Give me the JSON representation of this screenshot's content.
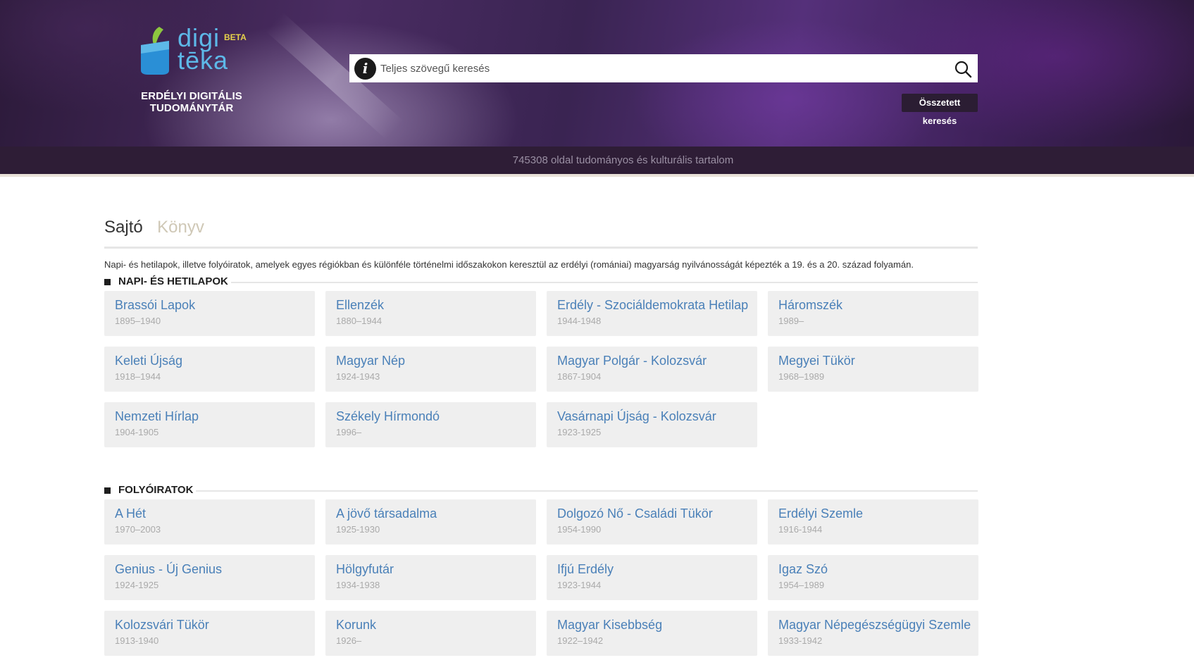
{
  "header": {
    "logo": {
      "line1": "digi",
      "line2": "tēka",
      "badge": "BETA"
    },
    "tagline": "ERDÉLYI DIGITÁLIS TUDOMÁNYTÁR",
    "search": {
      "placeholder": "Teljes szövegű keresés",
      "value": ""
    },
    "advanced_search_label": "Összetett keresés",
    "icons": {
      "info": "info-icon",
      "search": "search-icon"
    },
    "colors": {
      "logo_text": "#5db8e8",
      "logo_leaf": "#8dc63f",
      "badge": "#e6d24a"
    }
  },
  "stats": {
    "text": "745308 oldal tudományos és kulturális tartalom"
  },
  "tabs": [
    {
      "label": "Sajtó",
      "active": true
    },
    {
      "label": "Könyv",
      "active": false
    }
  ],
  "description": "Napi- és hetilapok, illetve folyóiratok, amelyek egyes régiókban és különféle történelmi időszakokon keresztül az erdélyi (romániai) magyarság nyilvánosságát képezték a 19. és a 20. század folyamán.",
  "sections": [
    {
      "title": "NAPI- ÉS HETILAPOK",
      "items": [
        {
          "name": "Brassói Lapok",
          "years": "1895–1940"
        },
        {
          "name": "Ellenzék",
          "years": "1880–1944"
        },
        {
          "name": "Erdély - Szociáldemokrata Hetilap",
          "years": "1944-1948"
        },
        {
          "name": "Háromszék",
          "years": "1989–"
        },
        {
          "name": "Keleti Újság",
          "years": "1918–1944"
        },
        {
          "name": "Magyar Nép",
          "years": "1924-1943"
        },
        {
          "name": "Magyar Polgár - Kolozsvár",
          "years": "1867-1904"
        },
        {
          "name": "Megyei Tükör",
          "years": "1968–1989"
        },
        {
          "name": "Nemzeti Hírlap",
          "years": "1904-1905"
        },
        {
          "name": "Székely Hírmondó",
          "years": "1996–"
        },
        {
          "name": "Vasárnapi Újság - Kolozsvár",
          "years": "1923-1925"
        }
      ]
    },
    {
      "title": "FOLYÓIRATOK",
      "items": [
        {
          "name": "A Hét",
          "years": "1970–2003"
        },
        {
          "name": "A jövő társadalma",
          "years": "1925-1930"
        },
        {
          "name": "Dolgozó Nő - Családi Tükör",
          "years": "1954-1990"
        },
        {
          "name": "Erdélyi Szemle",
          "years": "1916-1944"
        },
        {
          "name": "Genius - Új Genius",
          "years": "1924-1925"
        },
        {
          "name": "Hölgyfutár",
          "years": "1934-1938"
        },
        {
          "name": "Ifjú Erdély",
          "years": "1923-1944"
        },
        {
          "name": "Igaz Szó",
          "years": "1954–1989"
        },
        {
          "name": "Kolozsvári Tükör",
          "years": "1913-1940"
        },
        {
          "name": "Korunk",
          "years": "1926–"
        },
        {
          "name": "Magyar Kisebbség",
          "years": "1922–1942"
        },
        {
          "name": "Magyar Népegészségügyi Szemle",
          "years": "1933-1942"
        }
      ]
    }
  ]
}
